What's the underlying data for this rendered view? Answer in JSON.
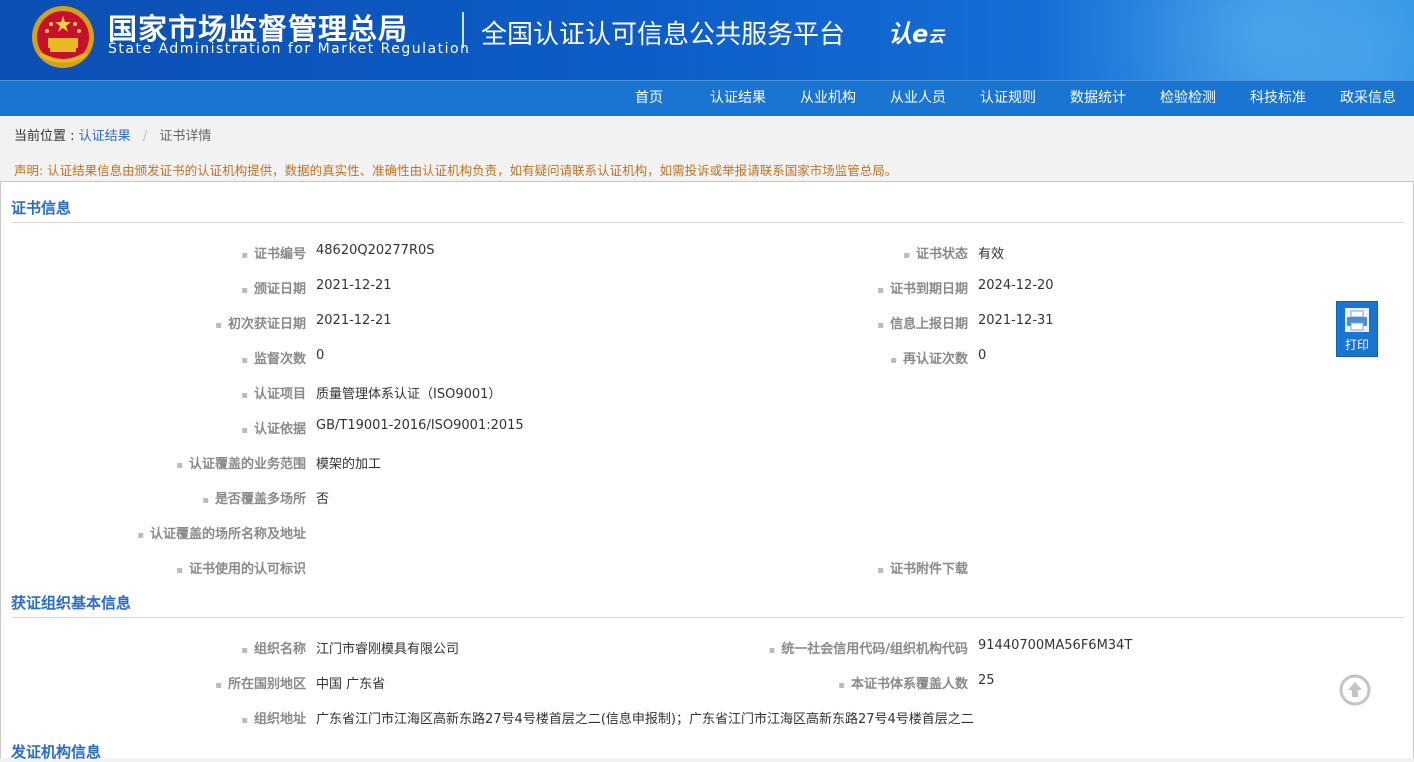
{
  "header": {
    "agency_cn": "国家市场监督管理总局",
    "agency_en": "State Administration for Market Regulation",
    "platform_title": "全国认证认可信息公共服务平台",
    "logo_text_a": "认",
    "logo_text_b": "e",
    "logo_text_c": "云"
  },
  "nav": {
    "items": [
      "首页",
      "认证结果",
      "从业机构",
      "从业人员",
      "认证规则",
      "数据统计",
      "检验检测",
      "科技标准",
      "政采信息"
    ]
  },
  "breadcrumb": {
    "prefix": "当前位置 :",
    "link": "认证结果",
    "separator": "/",
    "current": "证书详情"
  },
  "notice": "声明: 认证结果信息由颁发证书的认证机构提供，数据的真实性、准确性由认证机构负责，如有疑问请联系认证机构，如需投诉或举报请联系国家市场监管总局。",
  "cert_section": {
    "title": "证书信息",
    "cert_no_label": "证书编号",
    "cert_no": "48620Q20277R0S",
    "status_label": "证书状态",
    "status": "有效",
    "issue_date_label": "颁证日期",
    "issue_date": "2021-12-21",
    "expire_date_label": "证书到期日期",
    "expire_date": "2024-12-20",
    "first_date_label": "初次获证日期",
    "first_date": "2021-12-21",
    "report_date_label": "信息上报日期",
    "report_date": "2021-12-31",
    "supervision_label": "监督次数",
    "supervision": "0",
    "recert_label": "再认证次数",
    "recert": "0",
    "project_label": "认证项目",
    "project": "质量管理体系认证（ISO9001）",
    "basis_label": "认证依据",
    "basis": "GB/T19001-2016/ISO9001:2015",
    "scope_label": "认证覆盖的业务范围",
    "scope": "模架的加工",
    "multisite_label": "是否覆盖多场所",
    "multisite": "否",
    "sites_label": "认证覆盖的场所名称及地址",
    "mark_label": "证书使用的认可标识",
    "attachment_label": "证书附件下载"
  },
  "org_section": {
    "title": "获证组织基本信息",
    "name_label": "组织名称",
    "name": "江门市睿刚模具有限公司",
    "credit_label": "统一社会信用代码/组织机构代码",
    "credit": "91440700MA56F6M34T",
    "region_label": "所在国别地区",
    "region": "中国 广东省",
    "headcount_label": "本证书体系覆盖人数",
    "headcount": "25",
    "address_label": "组织地址",
    "address": "广东省江门市江海区高新东路27号4号楼首层之二(信息申报制)；广东省江门市江海区高新东路27号4号楼首层之二"
  },
  "issuer_section": {
    "title": "发证机构信息"
  },
  "print": {
    "label": "打印"
  }
}
